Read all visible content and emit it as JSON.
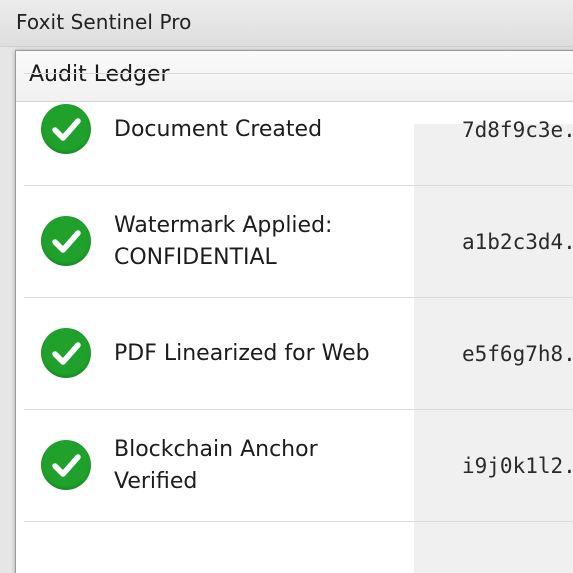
{
  "app": {
    "title": "Foxit Sentinel Pro"
  },
  "dialog": {
    "title": "Audit Ledger"
  },
  "entries": [
    {
      "label": "Document Created",
      "hash": "7d8f9c3e..."
    },
    {
      "label": "Watermark Applied: CONFIDENTIAL",
      "hash": "a1b2c3d4..."
    },
    {
      "label": "PDF Linearized for Web",
      "hash": "e5f6g7h8..."
    },
    {
      "label": "Blockchain Anchor Verified",
      "hash": "i9j0k1l2..."
    }
  ],
  "colors": {
    "success": "#1fa12c"
  },
  "icons": {
    "status": "check-circle-icon"
  }
}
